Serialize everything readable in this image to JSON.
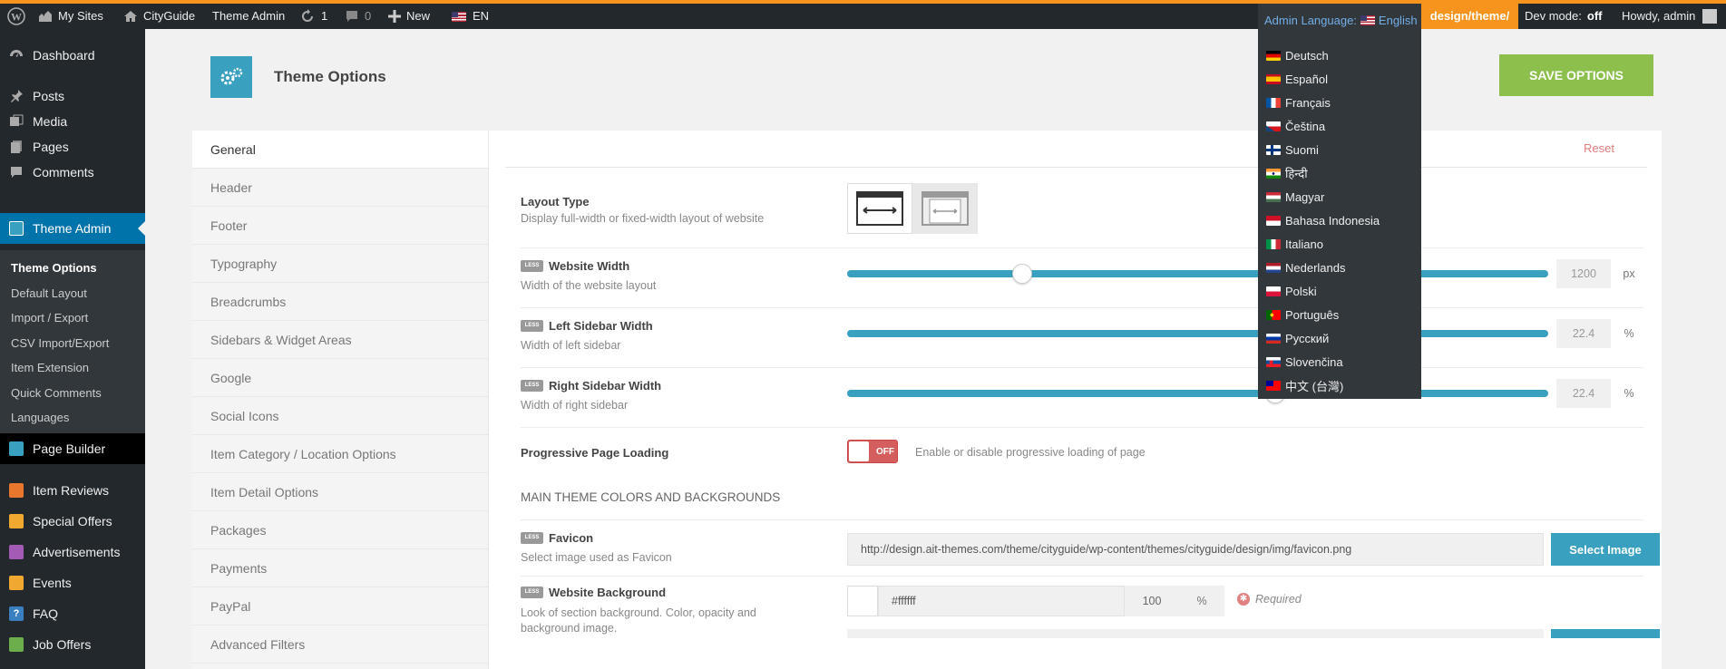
{
  "adminbar": {
    "my_sites": "My Sites",
    "site_name": "CityGuide",
    "theme_admin": "Theme Admin",
    "updates_count": "1",
    "comments_count": "0",
    "new_label": "New",
    "lang_short": "EN",
    "admin_language_label": "Admin Language:",
    "admin_language_value": "English",
    "dev_path": "design/theme/",
    "dev_mode_label": "Dev mode:",
    "dev_mode_value": "off",
    "howdy": "Howdy, admin"
  },
  "languages": [
    {
      "label": "Deutsch",
      "flag": "de"
    },
    {
      "label": "Español",
      "flag": "es"
    },
    {
      "label": "Français",
      "flag": "fr"
    },
    {
      "label": "Čeština",
      "flag": "cz"
    },
    {
      "label": "Suomi",
      "flag": "fi"
    },
    {
      "label": "हिन्दी",
      "flag": "in"
    },
    {
      "label": "Magyar",
      "flag": "hu"
    },
    {
      "label": "Bahasa Indonesia",
      "flag": "id"
    },
    {
      "label": "Italiano",
      "flag": "it"
    },
    {
      "label": "Nederlands",
      "flag": "nl"
    },
    {
      "label": "Polski",
      "flag": "pl"
    },
    {
      "label": "Português",
      "flag": "pt"
    },
    {
      "label": "Русский",
      "flag": "ru"
    },
    {
      "label": "Slovenčina",
      "flag": "sk"
    },
    {
      "label": "中文 (台灣)",
      "flag": "tw"
    }
  ],
  "sidebar": {
    "dashboard": "Dashboard",
    "posts": "Posts",
    "media": "Media",
    "pages": "Pages",
    "comments": "Comments",
    "theme_admin": "Theme Admin",
    "submenu": [
      "Theme Options",
      "Default Layout",
      "Import / Export",
      "CSV Import/Export",
      "Item Extension",
      "Quick Comments",
      "Languages"
    ],
    "page_builder": "Page Builder",
    "item_reviews": "Item Reviews",
    "special_offers": "Special Offers",
    "advertisements": "Advertisements",
    "events": "Events",
    "faq": "FAQ",
    "job_offers": "Job Offers"
  },
  "header": {
    "title": "Theme Options",
    "save_label": "SAVE OPTIONS"
  },
  "tabs": [
    "General",
    "Header",
    "Footer",
    "Typography",
    "Breadcrumbs",
    "Sidebars & Widget Areas",
    "Google",
    "Social Icons",
    "Item Category / Location Options",
    "Item Detail Options",
    "Packages",
    "Payments",
    "PayPal",
    "Advanced Filters"
  ],
  "reset_label": "Reset",
  "less_badge": "LESS",
  "options": {
    "layout_type": {
      "title": "Layout Type",
      "desc": "Display full-width or fixed-width layout of website"
    },
    "website_width": {
      "title": "Website Width",
      "desc": "Width of the website layout",
      "value": "1200",
      "unit": "px",
      "position": 0.25
    },
    "left_sidebar": {
      "title": "Left Sidebar Width",
      "desc": "Width of left sidebar",
      "value": "22.4",
      "unit": "%"
    },
    "right_sidebar": {
      "title": "Right Sidebar Width",
      "desc": "Width of right sidebar",
      "value": "22.4",
      "unit": "%",
      "position": 0.61
    },
    "progressive": {
      "title": "Progressive Page Loading",
      "toggle": "OFF",
      "desc": "Enable or disable progressive loading of page"
    },
    "section_heading": "MAIN THEME COLORS AND BACKGROUNDS",
    "favicon": {
      "title": "Favicon",
      "desc": "Select image used as Favicon",
      "url": "http://design.ait-themes.com/theme/cityguide/wp-content/themes/cityguide/design/img/favicon.png",
      "button": "Select Image"
    },
    "website_background": {
      "title": "Website Background",
      "desc": "Look of section background. Color, opacity and background image.",
      "color": "#ffffff",
      "opacity": "100",
      "unit": "%",
      "required": "Required"
    }
  },
  "colors": {
    "accent": "#3aa0c0",
    "save": "#8cbf4b",
    "adminbar": "#23282d",
    "orange": "#f7941d"
  }
}
